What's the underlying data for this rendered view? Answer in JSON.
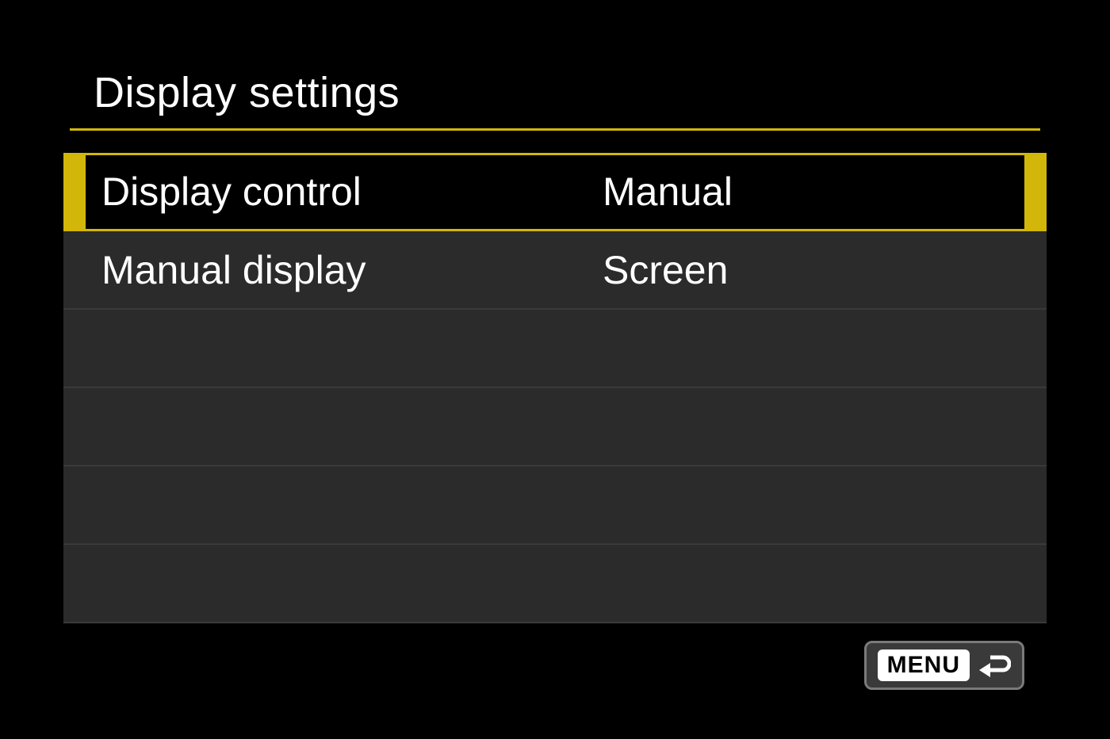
{
  "colors": {
    "accent": "#d3b60a",
    "row_bg": "#2b2b2b",
    "border": "#3a3a3a"
  },
  "header": {
    "title": "Display settings"
  },
  "rows": [
    {
      "label": "Display control",
      "value": "Manual",
      "selected": true
    },
    {
      "label": "Manual display",
      "value": "Screen",
      "selected": false
    },
    {
      "label": "",
      "value": "",
      "selected": false
    },
    {
      "label": "",
      "value": "",
      "selected": false
    },
    {
      "label": "",
      "value": "",
      "selected": false
    },
    {
      "label": "",
      "value": "",
      "selected": false
    }
  ],
  "footer": {
    "menu_label": "MENU",
    "back_icon": "return-icon"
  }
}
